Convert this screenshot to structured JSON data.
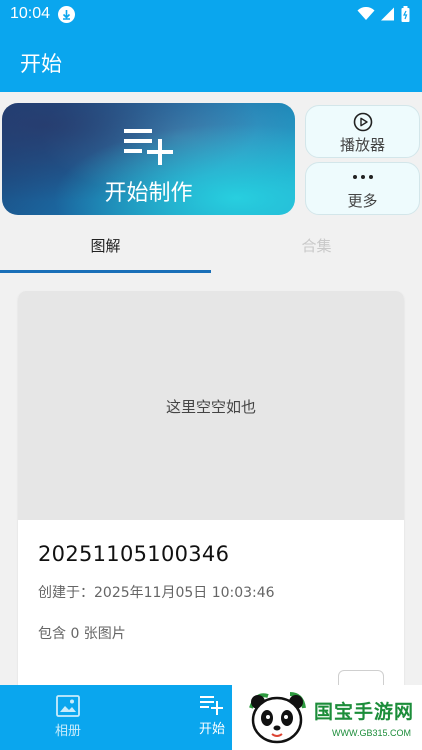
{
  "status_bar": {
    "time": "10:04"
  },
  "app_bar": {
    "title": "开始"
  },
  "hero": {
    "label": "开始制作"
  },
  "side_cards": {
    "player_label": "播放器",
    "more_label": "更多"
  },
  "tabs": [
    {
      "label": "图解",
      "active": true
    },
    {
      "label": "合集",
      "active": false
    }
  ],
  "card": {
    "empty_text": "这里空空如也",
    "title": "20251105100346",
    "created": "创建于：2025年11月05日 10:03:46",
    "count": "包含 0 张图片"
  },
  "bottom_nav": [
    {
      "label": "相册"
    },
    {
      "label": "开始"
    }
  ],
  "watermark": {
    "title": "国宝手游网",
    "sub": "WWW.GB315.COM"
  },
  "colors": {
    "primary": "#0aa6ee",
    "tab_indicator": "#1a6fb8",
    "watermark_green": "#1c8d3a"
  }
}
